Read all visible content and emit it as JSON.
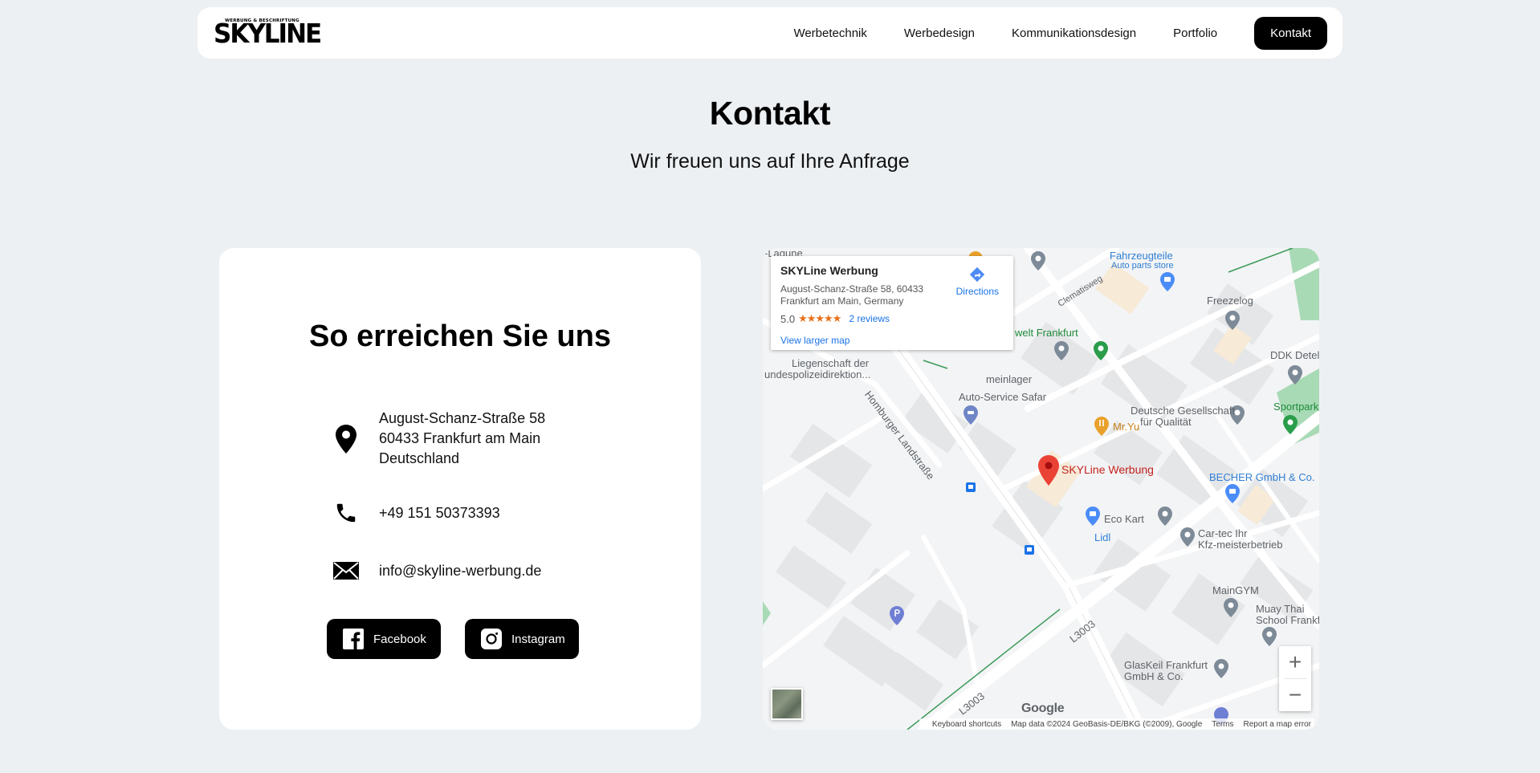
{
  "nav": {
    "logo_tagline": "WERBUNG & BESCHRIFTUNG",
    "logo_word": "SKYLINE",
    "items": [
      "Werbetechnik",
      "Werbedesign",
      "Kommunikationsdesign",
      "Portfolio"
    ],
    "cta": "Kontakt"
  },
  "header": {
    "title": "Kontakt",
    "subtitle": "Wir freuen uns auf Ihre Anfrage"
  },
  "contact": {
    "title": "So erreichen Sie uns",
    "address_line1": "August-Schanz-Straße 58",
    "address_line2": "60433 Frankfurt am Main",
    "address_line3": "Deutschland",
    "phone": "+49 151 50373393",
    "email": "info@skyline-werbung.de",
    "facebook": "Facebook",
    "instagram": "Instagram"
  },
  "map": {
    "place_name": "SKYLine Werbung",
    "place_address": "August-Schanz-Straße 58, 60433 Frankfurt am Main, Germany",
    "rating": "5.0",
    "stars": "★★★★★",
    "reviews": "2 reviews",
    "larger_map": "View larger map",
    "directions": "Directions",
    "zoom_in": "+",
    "zoom_out": "−",
    "google": "Google",
    "attribution": {
      "shortcuts": "Keyboard shortcuts",
      "data": "Map data ©2024 GeoBasis-DE/BKG (©2009), Google",
      "terms": "Terms",
      "report": "Report a map error"
    },
    "labels": {
      "laguna": "-Lagune",
      "fahrzeugteile": "Fahrzeugteile",
      "autoparts": "Auto parts store",
      "clematisweg": "Clematisweg",
      "freezelog": "Freezelog",
      "ddk": "DDK Detel",
      "welt": "welt Frankfurt",
      "liegenschaft1": "Liegenschaft der",
      "liegenschaft2": "undespolizeidirektion...",
      "homburger": "Homburger Landstraße",
      "meinlager": "meinlager",
      "autoservice": "Auto-Service Safar",
      "sportpark": "Sportpark",
      "mryu": "Mr.Yu",
      "dgq1": "Deutsche Gesellschaft",
      "dgq2": "für Qualität",
      "skyline": "SKYLine Werbung",
      "becher": "BECHER GmbH & Co.",
      "ecokart": "Eco Kart",
      "lidl": "Lidl",
      "cartec1": "Car-tec Ihr",
      "cartec2": "Kfz-meisterbetrieb",
      "maingym": "MainGYM",
      "muaythai1": "Muay Thai",
      "muaythai2": "School Frankf",
      "l3003": "L3003",
      "l3003b": "L3003",
      "glaskeil1": "GlasKeil Frankfurt",
      "glaskeil2": "GmbH & Co."
    }
  }
}
